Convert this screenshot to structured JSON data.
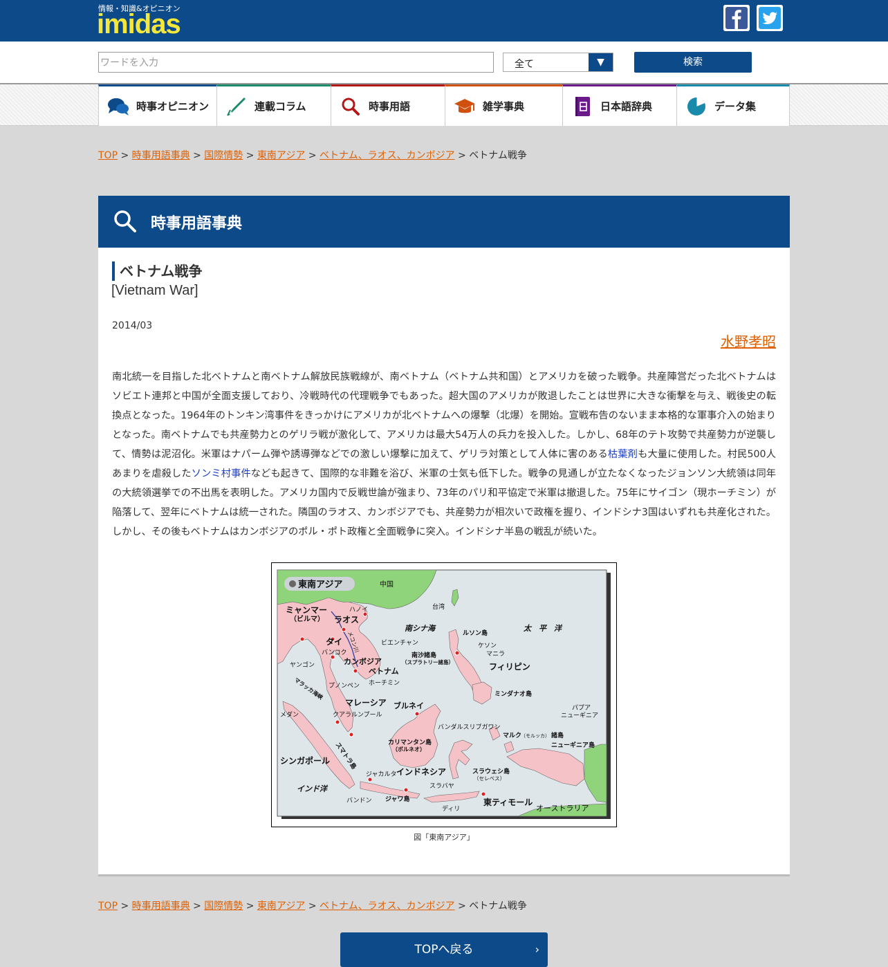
{
  "header": {
    "tagline": "情報・知識&オピニオン",
    "logo": "imidas",
    "facebook_icon": "facebook-icon",
    "twitter_icon": "twitter-icon"
  },
  "search": {
    "placeholder": "ワードを入力",
    "category_selected": "全て",
    "dropdown_glyph": "▼",
    "button_label": "検索"
  },
  "nav": {
    "items": [
      {
        "label": "時事オピニオン",
        "icon": "speech-bubbles-icon",
        "color": "#0c4a8a"
      },
      {
        "label": "連載コラム",
        "icon": "pen-icon",
        "color": "#1a8a6a"
      },
      {
        "label": "時事用語",
        "icon": "magnifier-icon",
        "color": "#b21818"
      },
      {
        "label": "雑学事典",
        "icon": "graduation-cap-icon",
        "color": "#d05010"
      },
      {
        "label": "日本語辞典",
        "icon": "dictionary-book-icon",
        "color": "#6a1a8a"
      },
      {
        "label": "データ集",
        "icon": "pie-chart-icon",
        "color": "#1a8aaa"
      }
    ]
  },
  "breadcrumb": {
    "items": [
      "TOP",
      "時事用語事典",
      "国際情勢",
      "東南アジア",
      "ベトナム、ラオス、カンボジア"
    ],
    "separator": ">",
    "current": "ベトナム戦争"
  },
  "panel": {
    "title": "時事用語事典",
    "term": "ベトナム戦争",
    "term_en": "[Vietnam War]",
    "date": "2014/03",
    "author": "水野孝昭",
    "body_part1": "南北統一を目指した北ベトナムと南ベトナム解放民族戦線が、南ベトナム（ベトナム共和国）とアメリカを破った戦争。共産陣営だった北ベトナムはソビエト連邦と中国が全面支援しており、冷戦時代の代理戦争でもあった。超大国のアメリカが敗退したことは世界に大きな衝撃を与え、戦後史の転換点となった。1964年のトンキン湾事件をきっかけにアメリカが北ベトナムへの爆撃（北爆）を開始。宣戦布告のないまま本格的な軍事介入の始まりとなった。南ベトナムでも共産勢力とのゲリラ戦が激化して、アメリカは最大54万人の兵力を投入した。しかし、68年のテト攻勢で共産勢力が逆襲して、情勢は泥沼化。米軍はナパーム弾や誘導弾などでの激しい爆撃に加えて、ゲリラ対策として人体に害のある",
    "link1": "枯葉剤",
    "body_part2": "も大量に使用した。村民500人あまりを虐殺した",
    "link2": "ソンミ村事件",
    "body_part3": "なども起きて、国際的な非難を浴び、米軍の士気も低下した。戦争の見通しが立たなくなったジョンソン大統領は同年の大統領選挙での不出馬を表明した。アメリカ国内で反戦世論が強まり、73年のパリ和平協定で米軍は撤退した。75年にサイゴン（現ホーチミン）が陥落して、翌年にベトナムは統一された。隣国のラオス、カンボジアでも、共産勢力が相次いで政権を握り、インドシナ3国はいずれも共産化された。しかし、その後もベトナムはカンボジアのポル・ポト政権と全面戦争に突入。インドシナ半島の戦乱が続いた。",
    "caption": "図「東南アジア」"
  },
  "map": {
    "title": "東南アジア",
    "labels": {
      "china": "中国",
      "taiwan": "台湾",
      "hanoi": "ハノイ",
      "myanmar": "ミャンマー",
      "myanmar_sub": "（ビルマ）",
      "laos": "ラオス",
      "mekong": "メコン川",
      "south_china_sea": "南シナ海",
      "pacific": "太　平　洋",
      "luzon": "ルソン島",
      "vientiane": "ビエンチャン",
      "thai": "タイ",
      "bangkok": "バンコク",
      "spratly": "南沙諸島",
      "spratly_sub": "（スプラトリー諸島）",
      "quezon": "ケソン",
      "manila": "マニラ",
      "cambodia": "カンボジア",
      "yangon": "ヤンゴン",
      "vietnam": "ベトナム",
      "philippines": "フィリピン",
      "hochiminh": "ホーチミン",
      "phnompenh": "プノンペン",
      "malacca": "マラッカ海峡",
      "mindanao": "ミンダナオ島",
      "malaysia": "マレーシア",
      "brunei": "ブルネイ",
      "papua": "パプア",
      "newguinea": "ニューギニア",
      "medan": "メダン",
      "kl": "クアラルンプール",
      "bandar": "バンダルスリブガワン",
      "maluku": "マルク",
      "maluku_sub": "（モルッカ）",
      "maluku_suffix": "諸島",
      "newguinea_island": "ニューギニア島",
      "kalimantan": "カリマンタン島",
      "kalimantan_sub": "（ボルネオ）",
      "singapore": "シンガポール",
      "sumatra": "スマトラ島",
      "indonesia": "インドネシア",
      "jakarta": "ジャカルタ",
      "sulawesi": "スラウェシ島",
      "sulawesi_sub": "（セレベス）",
      "indian_ocean": "インド洋",
      "surabaya": "スラバヤ",
      "bandung": "バンドン",
      "java": "ジャワ島",
      "east_timor": "東ティモール",
      "dili": "ディリ",
      "australia": "オーストラリア"
    }
  },
  "footer": {
    "top_button": "TOPへ戻る",
    "arrow": "›"
  },
  "colors": {
    "brand_blue": "#0c4a8a",
    "link_orange": "#e06000",
    "logo_yellow": "#f5e83a",
    "map_sea": "#dfe6ea",
    "map_land_highlight": "#f5c3c7",
    "map_land_other": "#8fd47a"
  }
}
